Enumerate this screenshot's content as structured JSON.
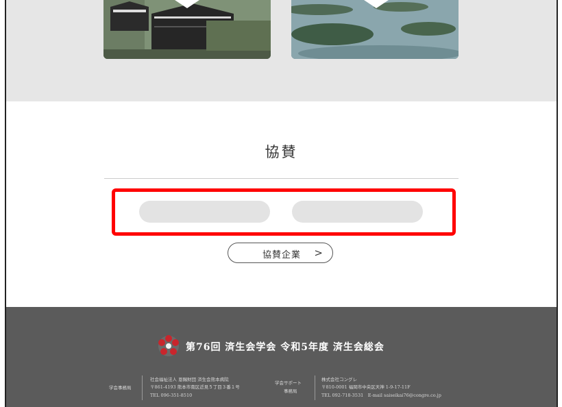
{
  "gallery": {
    "images": [
      {
        "alt": "castle-photo"
      },
      {
        "alt": "sea-islands-photo"
      }
    ]
  },
  "sponsors": {
    "title": "協賛",
    "more_label": "協賛企業",
    "more_icon": ">",
    "highlight_color": "#ff0000"
  },
  "footer": {
    "conference_title": "第76回 済生会学会 令和5年度 済生会総会",
    "secretariat": {
      "label": "学会事務局",
      "org": "社会福祉法人 恩賜財団 済生会熊本病院",
      "address": "〒861-4193 熊本市南区近見５丁目３番１号",
      "tel": "TEL 096-351-8510"
    },
    "support": {
      "label_line1": "学会サポート",
      "label_line2": "事務局",
      "org": "株式会社コングレ",
      "address": "〒810-0001 福岡市中央区天神 1-9-17-11F",
      "contact": "TEL 092-718-3531　E-mail saiseikai76@congre.co.jp"
    },
    "background": "#5b5b5b"
  }
}
